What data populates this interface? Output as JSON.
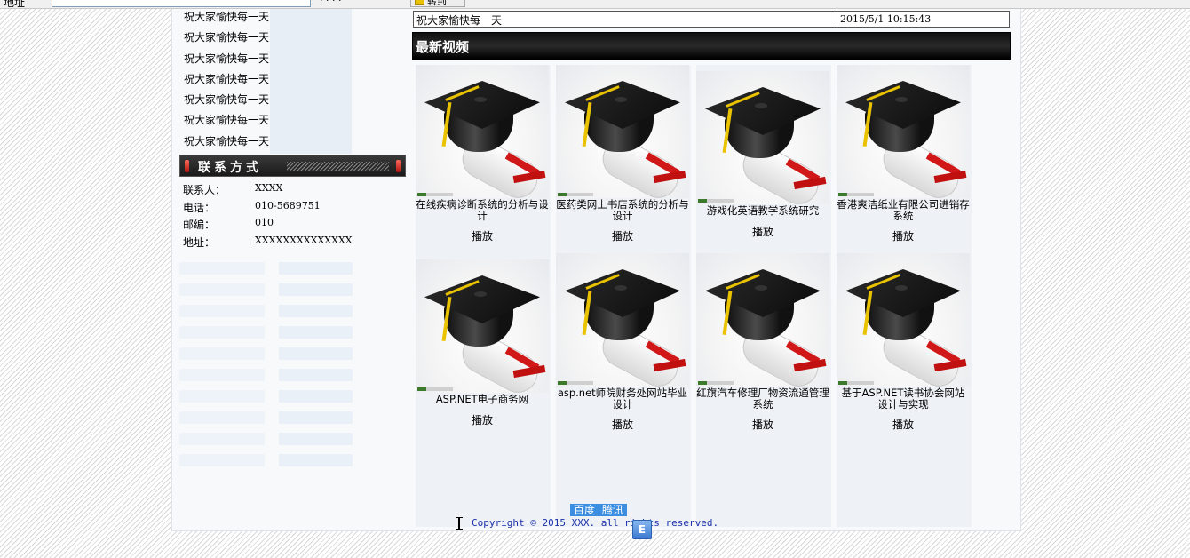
{
  "browser": {
    "address_label": "地址",
    "toolbar_text": "· · · ·",
    "go_label": "转到"
  },
  "sidebar": {
    "notices": [
      "祝大家愉快每一天",
      "祝大家愉快每一天",
      "祝大家愉快每一天",
      "祝大家愉快每一天",
      "祝大家愉快每一天",
      "祝大家愉快每一天",
      "祝大家愉快每一天"
    ],
    "contact_title": "联系方式",
    "contact": [
      {
        "key": "联系人：",
        "value": "XXXX"
      },
      {
        "key": "电话：",
        "value": "010-5689751"
      },
      {
        "key": "邮编：",
        "value": "010"
      },
      {
        "key": "地址：",
        "value": "XXXXXXXXXXXXXX"
      }
    ]
  },
  "marquee": {
    "message": "祝大家愉快每一天",
    "datetime": "2015/5/1 10:15:43"
  },
  "section": {
    "title": "最新视频"
  },
  "videos": [
    {
      "caption": "在线疾病诊断系统的分析与设计",
      "play": "播放"
    },
    {
      "caption": "医药类网上书店系统的分析与设计",
      "play": "播放"
    },
    {
      "caption": "游戏化英语教学系统研究",
      "play": "播放"
    },
    {
      "caption": "香港爽洁纸业有限公司进销存系统",
      "play": "播放"
    },
    {
      "caption": "ASP.NET电子商务网",
      "play": "播放"
    },
    {
      "caption": "asp.net师院财务处网站毕业设计",
      "play": "播放"
    },
    {
      "caption": "红旗汽车修理厂物资流通管理系统",
      "play": "播放"
    },
    {
      "caption": "基于ASP.NET读书协会网站设计与实现",
      "play": "播放"
    }
  ],
  "footer": {
    "links": [
      "百度",
      "腾讯"
    ],
    "copyright": "Copyright © 2015 XXX. all rights reserved.",
    "float_icon": "E"
  },
  "colors": {
    "section_head_bg": "#000000",
    "copyright_text": "#1a2fa8",
    "link_highlight": "#3b8ee0"
  }
}
